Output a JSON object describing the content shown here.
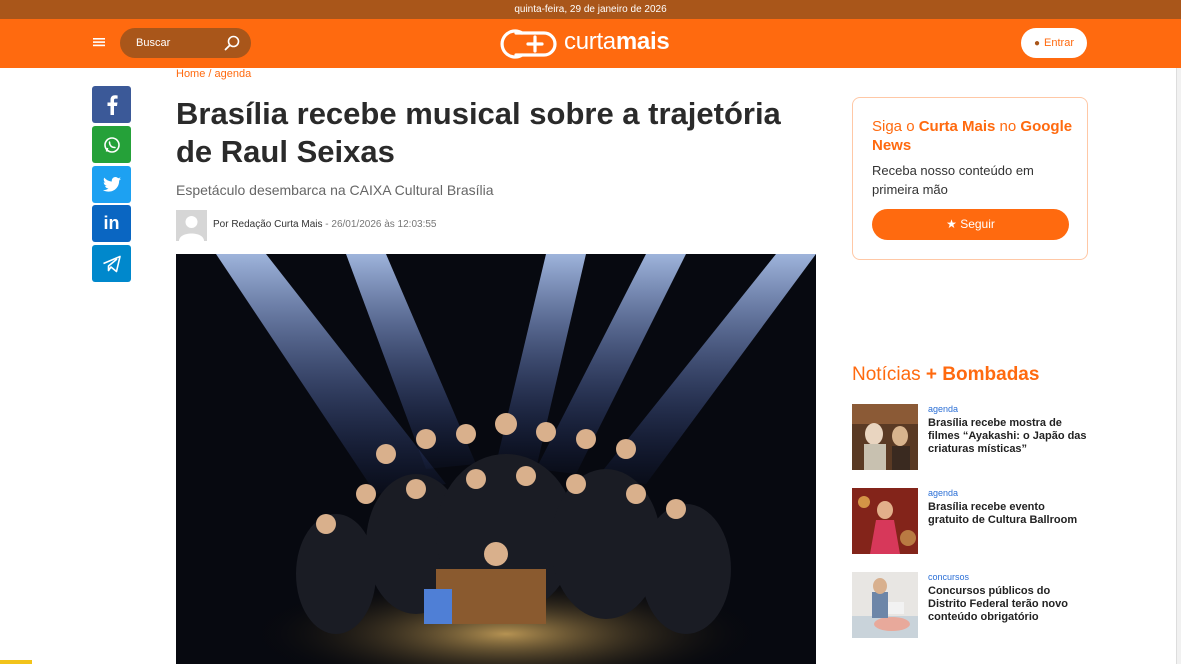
{
  "topbar": {
    "date": "quinta-feira, 29 de janeiro de 2026"
  },
  "header": {
    "search_label": "Buscar",
    "logo_light": "curta",
    "logo_bold": "mais",
    "login_label": "Entrar"
  },
  "share": {
    "items": [
      {
        "name": "facebook",
        "color": "#3b5998"
      },
      {
        "name": "whatsapp",
        "color": "#25a139"
      },
      {
        "name": "twitter",
        "color": "#1da1f2"
      },
      {
        "name": "linkedin",
        "color": "#0a66c2"
      },
      {
        "name": "telegram",
        "color": "#0088cc"
      }
    ]
  },
  "article": {
    "breadcrumb_home": "Home",
    "breadcrumb_sep": " / ",
    "breadcrumb_section": "agenda",
    "title": "Brasília recebe musical sobre a trajetória de Raul Seixas",
    "subtitle": "Espetáculo desembarca na CAIXA Cultural Brasília",
    "author": "Por Redação Curta Mais",
    "date": " - 26/01/2026 às 12:03:55"
  },
  "google_news": {
    "pre": "Siga o ",
    "brand": "Curta Mais",
    "mid": " no ",
    "service": "Google News",
    "text": "Receba nosso conteúdo em primeira mão",
    "button": "★ Seguir"
  },
  "bombadas": {
    "heading_light": "Notícias ",
    "heading_bold": "+ Bombadas",
    "items": [
      {
        "category": "agenda",
        "title": "Brasília recebe mostra de filmes “Ayakashi: o Japão das criaturas místicas”"
      },
      {
        "category": "agenda",
        "title": "Brasília recebe evento gratuito de Cultura Ballroom"
      },
      {
        "category": "concursos",
        "title": "Concursos públicos do Distrito Federal terão novo conteúdo obrigatório"
      }
    ]
  },
  "colors": {
    "brand_orange": "#ff6a0f",
    "topbar_brown": "#a9561a",
    "link_blue": "#2b6fd6"
  }
}
